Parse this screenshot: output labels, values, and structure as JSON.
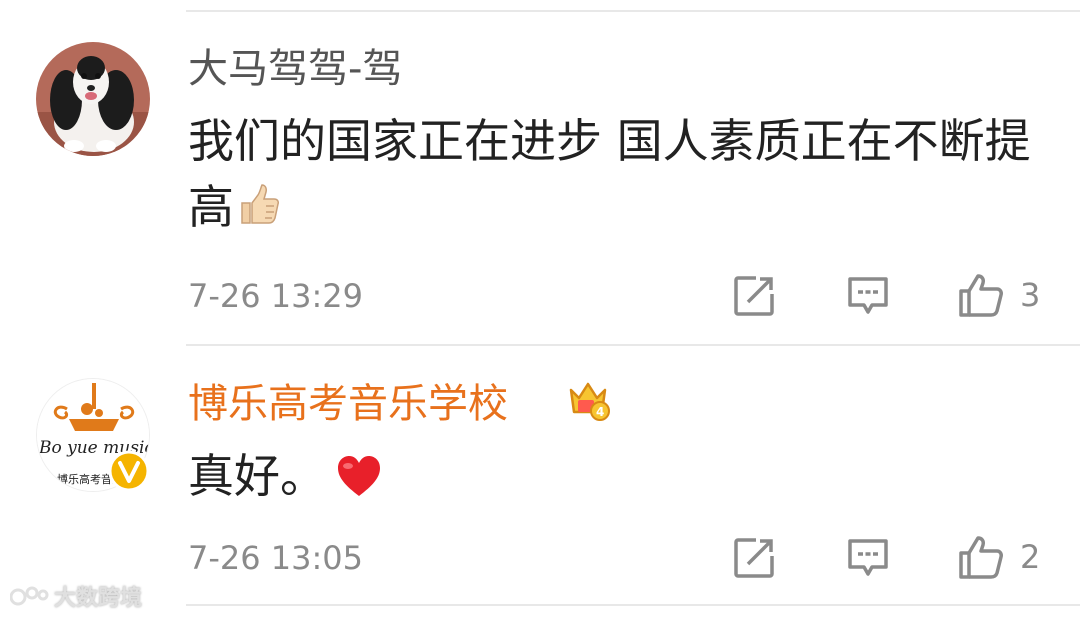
{
  "comments": [
    {
      "username": "大马驾驾-驾",
      "username_color": "#555555",
      "text": "我们的国家正在进步 国人素质正在不断提高",
      "emoji": "thumbs-up",
      "timestamp": "7-26 13:29",
      "like_count": "3"
    },
    {
      "username": "博乐高考音乐学校",
      "username_color": "#e8711c",
      "text": "真好。",
      "emoji": "red-heart",
      "timestamp": "7-26 13:05",
      "like_count": "2",
      "avatar_text_1": "Bo yue music",
      "avatar_text_2": "博乐高考音乐",
      "badges": [
        "vip-crown-icon",
        "verified-v-icon"
      ]
    }
  ],
  "watermark": {
    "text": "大数跨境"
  },
  "colors": {
    "text_primary": "#222222",
    "text_secondary": "#8a8a8a",
    "icon_gray": "#8a8a8a",
    "orange_name": "#e8711c",
    "verified_gold": "#f5b400"
  }
}
